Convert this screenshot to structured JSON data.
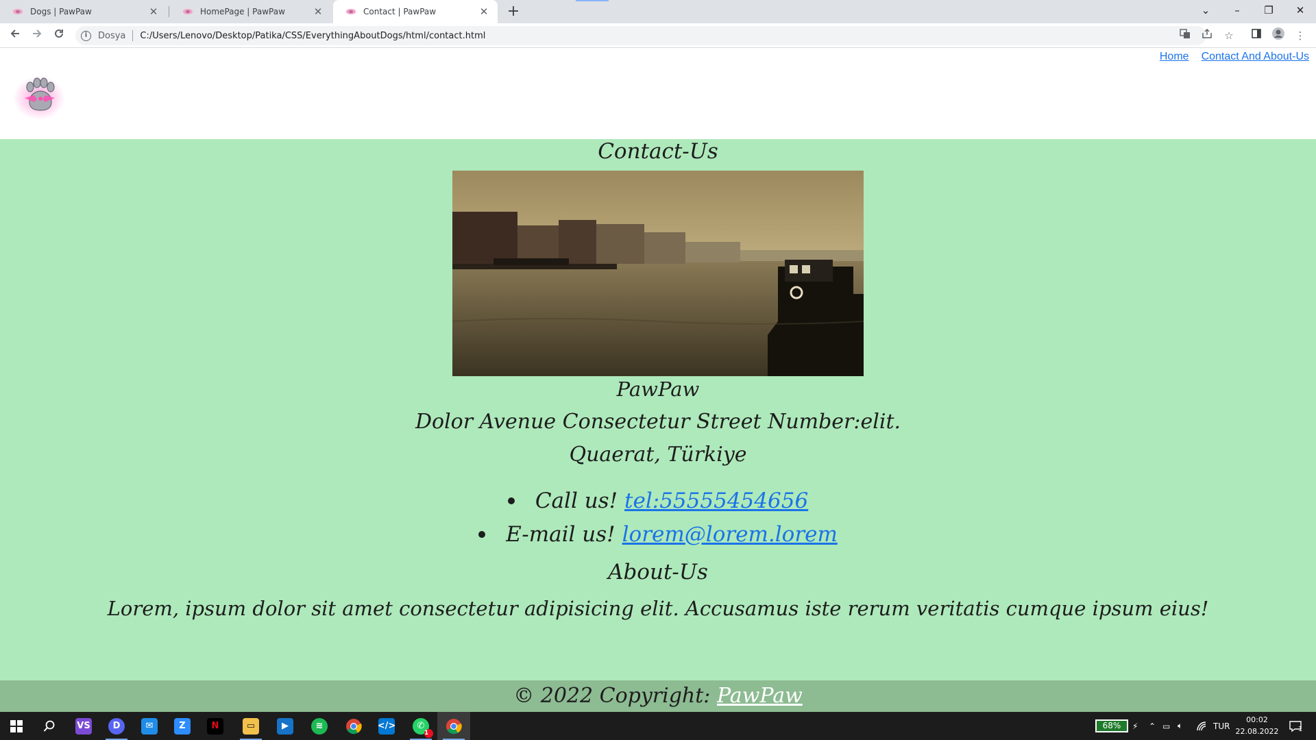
{
  "browser": {
    "tabs": [
      {
        "title": "Dogs | PawPaw",
        "active": false
      },
      {
        "title": "HomePage | PawPaw",
        "active": false
      },
      {
        "title": "Contact | PawPaw",
        "active": true
      }
    ],
    "address": {
      "scheme_label": "Dosya",
      "url": "C:/Users/Lenovo/Desktop/Patika/CSS/EverythingAboutDogs/html/contact.html"
    },
    "window_controls": {
      "tab_search": "⌄",
      "minimize": "–",
      "restore": "❐",
      "close": "✕"
    }
  },
  "site": {
    "nav": {
      "home": "Home",
      "contact_about": "Contact And About-Us"
    },
    "contact": {
      "heading": "Contact-Us",
      "brand": "PawPaw",
      "address_line1": "Dolor Avenue Consectetur Street Number:elit.",
      "address_line2": "Quaerat, Türkiye",
      "call_prefix": "Call us!",
      "phone_link": "tel:55555454656",
      "email_prefix": "E-mail us!",
      "email_link": "lorem@lorem.lorem"
    },
    "about": {
      "heading": "About-Us",
      "text": "Lorem, ipsum dolor sit amet consectetur adipisicing elit. Accusamus iste rerum veritatis cumque ipsum eius!"
    },
    "footer": {
      "copyright": "© 2022 Copyright:",
      "brand_link": "PawPaw"
    }
  },
  "taskbar": {
    "battery": "68%",
    "language": "TUR",
    "time": "00:02",
    "date": "22.08.2022",
    "notification_count": "1",
    "whatsapp_badge": "1"
  },
  "colors": {
    "page_bg": "#aee9bb",
    "footer_bg": "#8dbb92",
    "link": "#1a73e8"
  }
}
